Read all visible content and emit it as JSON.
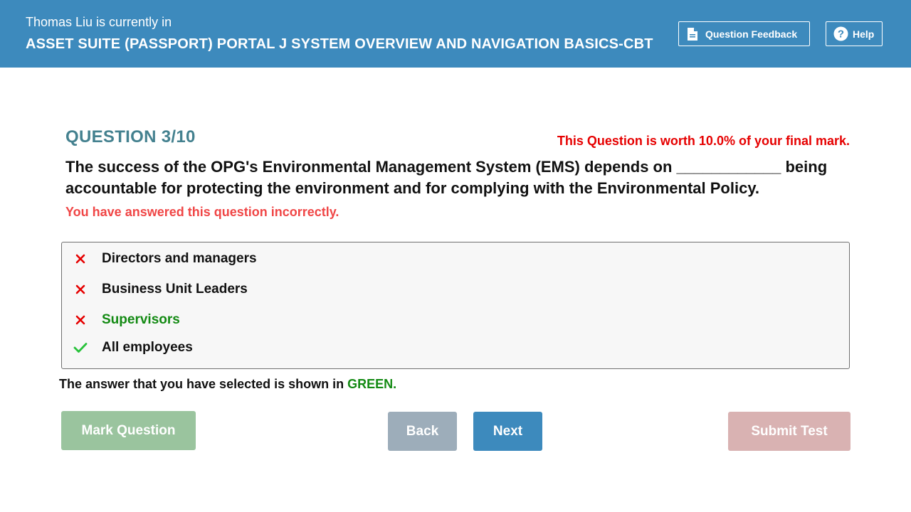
{
  "header": {
    "user_name": "Thomas Liu",
    "status_text": " is currently in",
    "course_title": "ASSET SUITE (PASSPORT) PORTAL J SYSTEM OVERVIEW AND NAVIGATION BASICS-CBT",
    "feedback_label": "Question Feedback",
    "help_label": "Help",
    "bar_color": "#3d8abd"
  },
  "question": {
    "number_label": "QUESTION 3/10",
    "worth_text": "This Question is worth 10.0% of your final mark.",
    "text": "The success of the OPG's Environmental Management System (EMS) depends on ____________ being accountable for protecting the environment and for complying with the Environmental Policy.",
    "result_text": "You have answered this question incorrectly."
  },
  "options": [
    {
      "label": "Directors and managers",
      "mark": "cross-icon",
      "selected": false
    },
    {
      "label": "Business Unit Leaders",
      "mark": "cross-icon",
      "selected": false
    },
    {
      "label": "Supervisors",
      "mark": "cross-icon",
      "selected": true
    },
    {
      "label": "All employees",
      "mark": "check-icon",
      "selected": false
    }
  ],
  "legend": {
    "prefix": "The answer that you have selected is shown in ",
    "highlight": "GREEN."
  },
  "buttons": {
    "mark_label": "Mark Question",
    "back_label": "Back",
    "next_label": "Next",
    "submit_label": "Submit Test"
  },
  "colors": {
    "correct_green": "#138a13",
    "incorrect_red": "#e60000",
    "question_teal": "#44818f"
  }
}
